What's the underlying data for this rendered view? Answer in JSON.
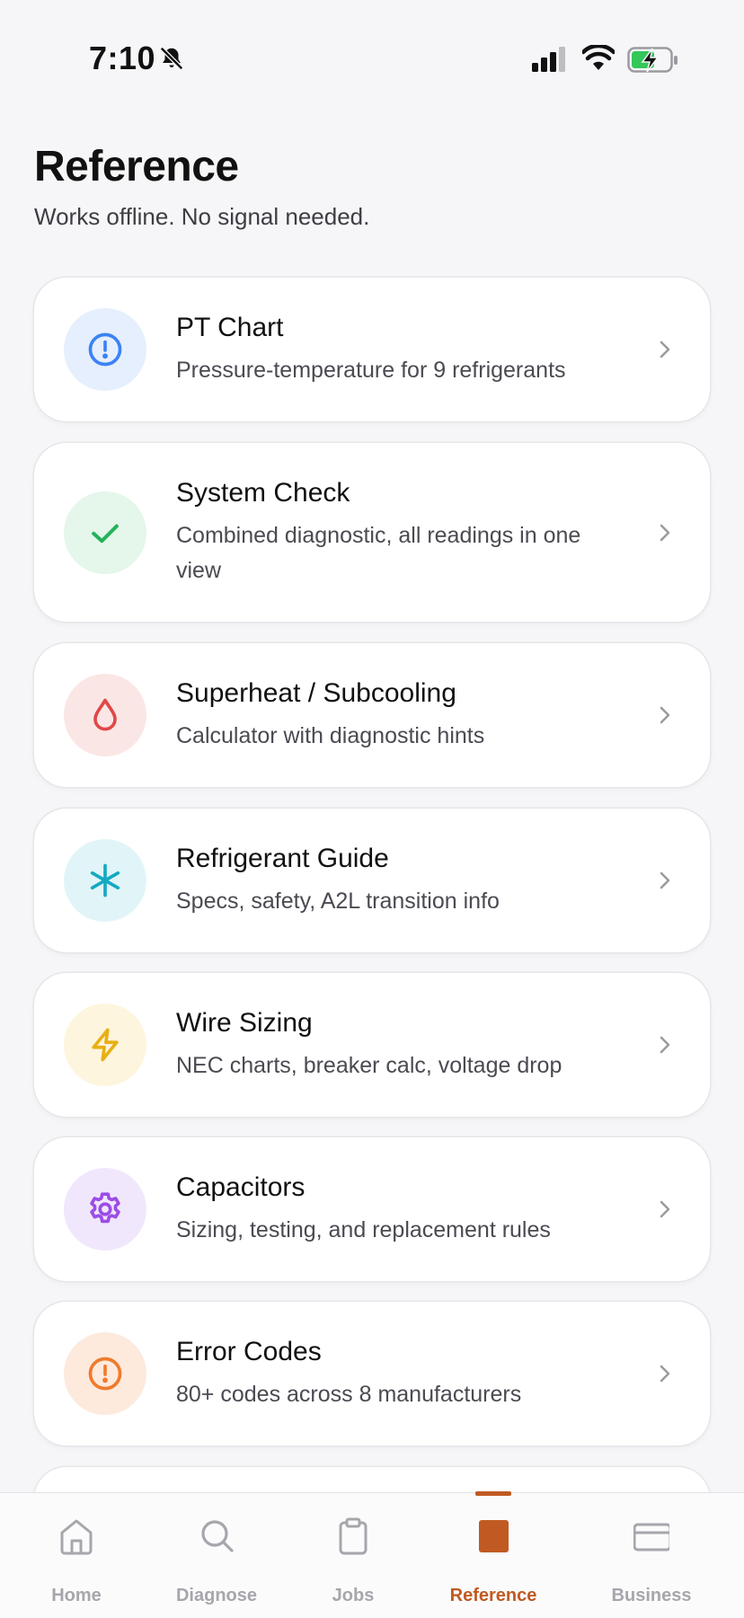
{
  "status_bar": {
    "time": "7:10"
  },
  "header": {
    "title": "Reference",
    "subtitle": "Works offline. No signal needed."
  },
  "cards": [
    {
      "title": "PT Chart",
      "description": "Pressure-temperature for 9 refrigerants",
      "icon": "info-circle-icon",
      "icon_color": "#3b82f6",
      "icon_bg": "#e6effd"
    },
    {
      "title": "System Check",
      "description": "Combined diagnostic, all readings in one view",
      "icon": "check-icon",
      "icon_color": "#22b35a",
      "icon_bg": "#e5f6ea"
    },
    {
      "title": "Superheat / Subcooling",
      "description": "Calculator with diagnostic hints",
      "icon": "droplet-icon",
      "icon_color": "#e04848",
      "icon_bg": "#fbe6e6"
    },
    {
      "title": "Refrigerant Guide",
      "description": "Specs, safety, A2L transition info",
      "icon": "snowflake-icon",
      "icon_color": "#14a9c4",
      "icon_bg": "#e1f5f8"
    },
    {
      "title": "Wire Sizing",
      "description": "NEC charts, breaker calc, voltage drop",
      "icon": "lightning-icon",
      "icon_color": "#e8b014",
      "icon_bg": "#fdf5dd"
    },
    {
      "title": "Capacitors",
      "description": "Sizing, testing, and replacement rules",
      "icon": "gear-icon",
      "icon_color": "#9b4de6",
      "icon_bg": "#f1e7fc"
    },
    {
      "title": "Error Codes",
      "description": "80+ codes across 8 manufacturers",
      "icon": "alert-circle-icon",
      "icon_color": "#f07a2c",
      "icon_bg": "#fdeadd"
    }
  ],
  "tabs": [
    {
      "label": "Home",
      "icon": "home-icon",
      "active": false
    },
    {
      "label": "Diagnose",
      "icon": "search-icon",
      "active": false
    },
    {
      "label": "Jobs",
      "icon": "clipboard-icon",
      "active": false
    },
    {
      "label": "Reference",
      "icon": "book-icon",
      "active": true
    },
    {
      "label": "Business",
      "icon": "card-icon",
      "active": false
    }
  ],
  "colors": {
    "accent": "#c05a22",
    "inactive_tab": "#a6a6ac",
    "background": "#f6f6f8"
  }
}
